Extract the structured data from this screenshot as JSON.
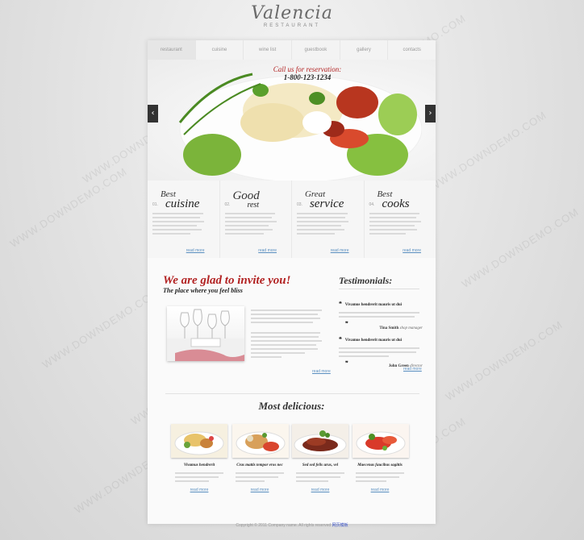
{
  "logo": {
    "name": "Valencia",
    "sub": "RESTAURANT"
  },
  "nav": [
    {
      "label": "restaurant",
      "active": true
    },
    {
      "label": "cuisine"
    },
    {
      "label": "wine list"
    },
    {
      "label": "guestbook"
    },
    {
      "label": "gallery"
    },
    {
      "label": "contacts"
    }
  ],
  "slider": {
    "call_line1": "Call us for reservation:",
    "call_line2": "1-800-123-1234",
    "prev_icon": "‹",
    "next_icon": "›"
  },
  "features": [
    {
      "num": "01.",
      "top": "Best",
      "bottom": "cuisine",
      "more": "read more"
    },
    {
      "num": "02.",
      "top": "Good",
      "bottom": "rest",
      "more": "read more"
    },
    {
      "num": "03.",
      "top": "Great",
      "bottom": "service",
      "more": "read more"
    },
    {
      "num": "04.",
      "top": "Best",
      "bottom": "cooks",
      "more": "read more"
    }
  ],
  "invite": {
    "title": "We are glad to invite you!",
    "subtitle": "The place where you feel bliss",
    "more": "read more"
  },
  "testimonials": {
    "title": "Testimonials:",
    "items": [
      {
        "quote_bold": "Vivamus hendrerit mauris ut dui",
        "author": "Tina Smith",
        "role": "shop manager"
      },
      {
        "quote_bold": "Vivamus hendrerit mauris ut dui",
        "author": "John Green",
        "role": "director"
      }
    ],
    "more": "read more"
  },
  "delicious": {
    "title": "Most delicious:",
    "dishes": [
      {
        "caption": "Vivamus hendrerit",
        "more": "read more"
      },
      {
        "caption": "Cras mattis tempor eros nec",
        "more": "read more"
      },
      {
        "caption": "Sed sed felis urus, vel",
        "more": "read more"
      },
      {
        "caption": "Maecenas faucibus sagittis",
        "more": "read more"
      }
    ]
  },
  "footer": {
    "text": "Copyright © 2011 Company name. All rights reserved",
    "link": "网页模板"
  },
  "watermark": "WWW.DOWNDEMO.COM",
  "colors": {
    "accent_red": "#b22222",
    "link_blue": "#5a8fc0"
  }
}
